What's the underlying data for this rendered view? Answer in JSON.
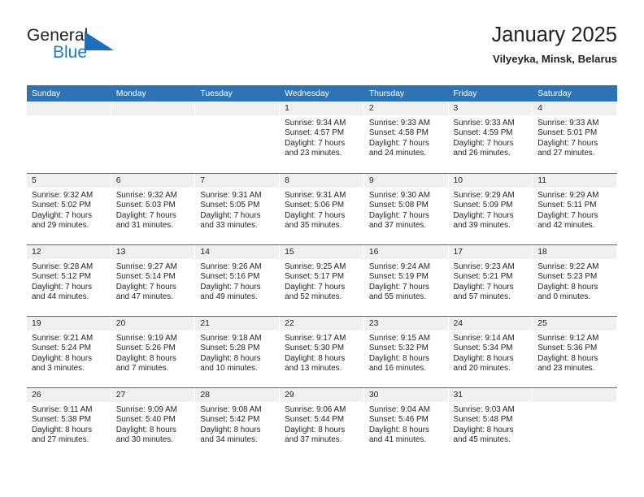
{
  "brand": {
    "name_part1": "General",
    "name_part2": "Blue",
    "logo_icon": "triangle-icon",
    "accent_color": "#1c7cc4"
  },
  "header": {
    "title": "January 2025",
    "subtitle": "Vilyeyka, Minsk, Belarus"
  },
  "colors": {
    "header_row_bg": "#2e74b5",
    "daynum_band_bg": "#f0f0f0",
    "week_divider": "#2e74b5",
    "text": "#231f20"
  },
  "weekday_headers": [
    "Sunday",
    "Monday",
    "Tuesday",
    "Wednesday",
    "Thursday",
    "Friday",
    "Saturday"
  ],
  "weeks": [
    [
      {
        "day": "",
        "sunrise": "",
        "sunset": "",
        "daylight_line1": "",
        "daylight_line2": ""
      },
      {
        "day": "",
        "sunrise": "",
        "sunset": "",
        "daylight_line1": "",
        "daylight_line2": ""
      },
      {
        "day": "",
        "sunrise": "",
        "sunset": "",
        "daylight_line1": "",
        "daylight_line2": ""
      },
      {
        "day": "1",
        "sunrise": "Sunrise: 9:34 AM",
        "sunset": "Sunset: 4:57 PM",
        "daylight_line1": "Daylight: 7 hours",
        "daylight_line2": "and 23 minutes."
      },
      {
        "day": "2",
        "sunrise": "Sunrise: 9:33 AM",
        "sunset": "Sunset: 4:58 PM",
        "daylight_line1": "Daylight: 7 hours",
        "daylight_line2": "and 24 minutes."
      },
      {
        "day": "3",
        "sunrise": "Sunrise: 9:33 AM",
        "sunset": "Sunset: 4:59 PM",
        "daylight_line1": "Daylight: 7 hours",
        "daylight_line2": "and 26 minutes."
      },
      {
        "day": "4",
        "sunrise": "Sunrise: 9:33 AM",
        "sunset": "Sunset: 5:01 PM",
        "daylight_line1": "Daylight: 7 hours",
        "daylight_line2": "and 27 minutes."
      }
    ],
    [
      {
        "day": "5",
        "sunrise": "Sunrise: 9:32 AM",
        "sunset": "Sunset: 5:02 PM",
        "daylight_line1": "Daylight: 7 hours",
        "daylight_line2": "and 29 minutes."
      },
      {
        "day": "6",
        "sunrise": "Sunrise: 9:32 AM",
        "sunset": "Sunset: 5:03 PM",
        "daylight_line1": "Daylight: 7 hours",
        "daylight_line2": "and 31 minutes."
      },
      {
        "day": "7",
        "sunrise": "Sunrise: 9:31 AM",
        "sunset": "Sunset: 5:05 PM",
        "daylight_line1": "Daylight: 7 hours",
        "daylight_line2": "and 33 minutes."
      },
      {
        "day": "8",
        "sunrise": "Sunrise: 9:31 AM",
        "sunset": "Sunset: 5:06 PM",
        "daylight_line1": "Daylight: 7 hours",
        "daylight_line2": "and 35 minutes."
      },
      {
        "day": "9",
        "sunrise": "Sunrise: 9:30 AM",
        "sunset": "Sunset: 5:08 PM",
        "daylight_line1": "Daylight: 7 hours",
        "daylight_line2": "and 37 minutes."
      },
      {
        "day": "10",
        "sunrise": "Sunrise: 9:29 AM",
        "sunset": "Sunset: 5:09 PM",
        "daylight_line1": "Daylight: 7 hours",
        "daylight_line2": "and 39 minutes."
      },
      {
        "day": "11",
        "sunrise": "Sunrise: 9:29 AM",
        "sunset": "Sunset: 5:11 PM",
        "daylight_line1": "Daylight: 7 hours",
        "daylight_line2": "and 42 minutes."
      }
    ],
    [
      {
        "day": "12",
        "sunrise": "Sunrise: 9:28 AM",
        "sunset": "Sunset: 5:12 PM",
        "daylight_line1": "Daylight: 7 hours",
        "daylight_line2": "and 44 minutes."
      },
      {
        "day": "13",
        "sunrise": "Sunrise: 9:27 AM",
        "sunset": "Sunset: 5:14 PM",
        "daylight_line1": "Daylight: 7 hours",
        "daylight_line2": "and 47 minutes."
      },
      {
        "day": "14",
        "sunrise": "Sunrise: 9:26 AM",
        "sunset": "Sunset: 5:16 PM",
        "daylight_line1": "Daylight: 7 hours",
        "daylight_line2": "and 49 minutes."
      },
      {
        "day": "15",
        "sunrise": "Sunrise: 9:25 AM",
        "sunset": "Sunset: 5:17 PM",
        "daylight_line1": "Daylight: 7 hours",
        "daylight_line2": "and 52 minutes."
      },
      {
        "day": "16",
        "sunrise": "Sunrise: 9:24 AM",
        "sunset": "Sunset: 5:19 PM",
        "daylight_line1": "Daylight: 7 hours",
        "daylight_line2": "and 55 minutes."
      },
      {
        "day": "17",
        "sunrise": "Sunrise: 9:23 AM",
        "sunset": "Sunset: 5:21 PM",
        "daylight_line1": "Daylight: 7 hours",
        "daylight_line2": "and 57 minutes."
      },
      {
        "day": "18",
        "sunrise": "Sunrise: 9:22 AM",
        "sunset": "Sunset: 5:23 PM",
        "daylight_line1": "Daylight: 8 hours",
        "daylight_line2": "and 0 minutes."
      }
    ],
    [
      {
        "day": "19",
        "sunrise": "Sunrise: 9:21 AM",
        "sunset": "Sunset: 5:24 PM",
        "daylight_line1": "Daylight: 8 hours",
        "daylight_line2": "and 3 minutes."
      },
      {
        "day": "20",
        "sunrise": "Sunrise: 9:19 AM",
        "sunset": "Sunset: 5:26 PM",
        "daylight_line1": "Daylight: 8 hours",
        "daylight_line2": "and 7 minutes."
      },
      {
        "day": "21",
        "sunrise": "Sunrise: 9:18 AM",
        "sunset": "Sunset: 5:28 PM",
        "daylight_line1": "Daylight: 8 hours",
        "daylight_line2": "and 10 minutes."
      },
      {
        "day": "22",
        "sunrise": "Sunrise: 9:17 AM",
        "sunset": "Sunset: 5:30 PM",
        "daylight_line1": "Daylight: 8 hours",
        "daylight_line2": "and 13 minutes."
      },
      {
        "day": "23",
        "sunrise": "Sunrise: 9:15 AM",
        "sunset": "Sunset: 5:32 PM",
        "daylight_line1": "Daylight: 8 hours",
        "daylight_line2": "and 16 minutes."
      },
      {
        "day": "24",
        "sunrise": "Sunrise: 9:14 AM",
        "sunset": "Sunset: 5:34 PM",
        "daylight_line1": "Daylight: 8 hours",
        "daylight_line2": "and 20 minutes."
      },
      {
        "day": "25",
        "sunrise": "Sunrise: 9:12 AM",
        "sunset": "Sunset: 5:36 PM",
        "daylight_line1": "Daylight: 8 hours",
        "daylight_line2": "and 23 minutes."
      }
    ],
    [
      {
        "day": "26",
        "sunrise": "Sunrise: 9:11 AM",
        "sunset": "Sunset: 5:38 PM",
        "daylight_line1": "Daylight: 8 hours",
        "daylight_line2": "and 27 minutes."
      },
      {
        "day": "27",
        "sunrise": "Sunrise: 9:09 AM",
        "sunset": "Sunset: 5:40 PM",
        "daylight_line1": "Daylight: 8 hours",
        "daylight_line2": "and 30 minutes."
      },
      {
        "day": "28",
        "sunrise": "Sunrise: 9:08 AM",
        "sunset": "Sunset: 5:42 PM",
        "daylight_line1": "Daylight: 8 hours",
        "daylight_line2": "and 34 minutes."
      },
      {
        "day": "29",
        "sunrise": "Sunrise: 9:06 AM",
        "sunset": "Sunset: 5:44 PM",
        "daylight_line1": "Daylight: 8 hours",
        "daylight_line2": "and 37 minutes."
      },
      {
        "day": "30",
        "sunrise": "Sunrise: 9:04 AM",
        "sunset": "Sunset: 5:46 PM",
        "daylight_line1": "Daylight: 8 hours",
        "daylight_line2": "and 41 minutes."
      },
      {
        "day": "31",
        "sunrise": "Sunrise: 9:03 AM",
        "sunset": "Sunset: 5:48 PM",
        "daylight_line1": "Daylight: 8 hours",
        "daylight_line2": "and 45 minutes."
      },
      {
        "day": "",
        "sunrise": "",
        "sunset": "",
        "daylight_line1": "",
        "daylight_line2": ""
      }
    ]
  ]
}
